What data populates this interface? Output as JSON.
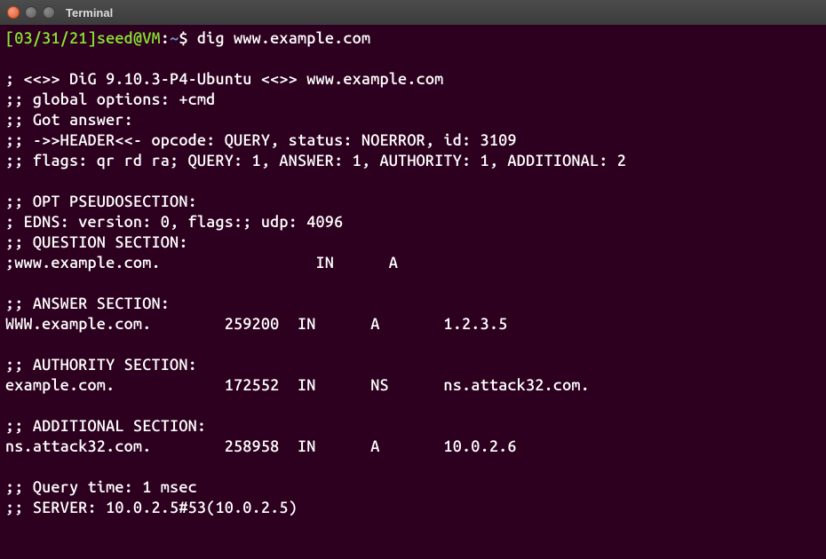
{
  "window": {
    "title": "Terminal"
  },
  "prompt": {
    "date": "[03/31/21]",
    "user_host": "seed@VM",
    "sep": ":",
    "path": "~",
    "symbol": "$ "
  },
  "command": "dig www.example.com",
  "dig": {
    "version_line": "; <<>> DiG 9.10.3-P4-Ubuntu <<>> www.example.com",
    "global_options": ";; global options: +cmd",
    "got_answer": ";; Got answer:",
    "header": ";; ->>HEADER<<- opcode: QUERY, status: NOERROR, id: 3109",
    "flags": ";; flags: qr rd ra; QUERY: 1, ANSWER: 1, AUTHORITY: 1, ADDITIONAL: 2",
    "opt_header": ";; OPT PSEUDOSECTION:",
    "edns": "; EDNS: version: 0, flags:; udp: 4096",
    "question_header": ";; QUESTION SECTION:",
    "question": {
      "name": ";www.example.com.",
      "class": "IN",
      "type": "A"
    },
    "answer_header": ";; ANSWER SECTION:",
    "answer": {
      "name": "WWW.example.com.",
      "ttl": "259200",
      "class": "IN",
      "type": "A",
      "value": "1.2.3.5"
    },
    "authority_header": ";; AUTHORITY SECTION:",
    "authority": {
      "name": "example.com.",
      "ttl": "172552",
      "class": "IN",
      "type": "NS",
      "value": "ns.attack32.com."
    },
    "additional_header": ";; ADDITIONAL SECTION:",
    "additional": {
      "name": "ns.attack32.com.",
      "ttl": "258958",
      "class": "IN",
      "type": "A",
      "value": "10.0.2.6"
    },
    "query_time": ";; Query time: 1 msec",
    "server": ";; SERVER: 10.0.2.5#53(10.0.2.5)"
  },
  "columns": {
    "name_w": 24,
    "ttl_w": 8,
    "class_w": 8,
    "type_w": 8
  }
}
